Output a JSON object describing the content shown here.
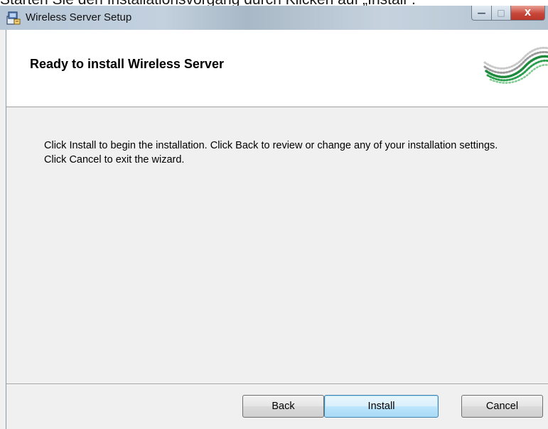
{
  "document": {
    "caption": "Starten Sie den Installationsvorgang durch Klicken auf „Install“."
  },
  "window": {
    "title": "Wireless Server Setup",
    "app_icon": "installer-icon",
    "controls": {
      "minimize": "—",
      "maximize": "□",
      "close": "X"
    }
  },
  "header": {
    "title": "Ready to install Wireless Server",
    "logo": "green-wave-logo"
  },
  "body": {
    "message": "Click Install to begin the installation. Click Back to review or change any of your installation settings. Click Cancel to exit the wizard."
  },
  "buttons": {
    "back": "Back",
    "install": "Install",
    "cancel": "Cancel"
  },
  "colors": {
    "titlebar": "#b6c6d6",
    "close_button": "#c7473a",
    "default_button": "#bee6fd",
    "logo_green": "#1e8a3c"
  }
}
